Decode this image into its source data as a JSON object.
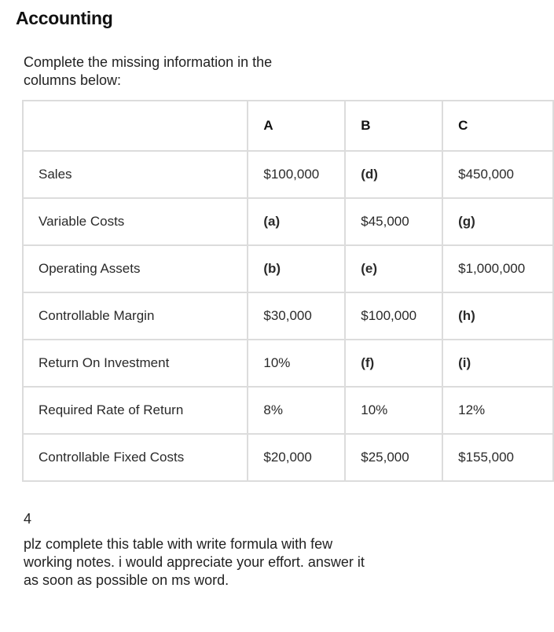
{
  "title": "Accounting",
  "intro": "Complete the missing information in the columns below:",
  "table": {
    "headers": [
      "",
      "A",
      "B",
      "C"
    ],
    "rows": [
      {
        "label": "Sales",
        "A": "$100,000",
        "B": "(d)",
        "C": "$450,000"
      },
      {
        "label": "Variable Costs",
        "A": "(a)",
        "B": "$45,000",
        "C": "(g)"
      },
      {
        "label": "Operating Assets",
        "A": "(b)",
        "B": "(e)",
        "C": "$1,000,000"
      },
      {
        "label": "Controllable Margin",
        "A": "$30,000",
        "B": "$100,000",
        "C": "(h)"
      },
      {
        "label": "Return On Investment",
        "A": "10%",
        "B": "(f)",
        "C": "(i)"
      },
      {
        "label": "Required Rate of Return",
        "A": "8%",
        "B": "10%",
        "C": "12%"
      },
      {
        "label": "Controllable Fixed Costs",
        "A": "$20,000",
        "B": "$25,000",
        "C": "$155,000"
      }
    ]
  },
  "page_number": "4",
  "note": "plz complete this table with write formula with few working notes. i would appreciate your effort. answer it as soon as possible on ms word."
}
